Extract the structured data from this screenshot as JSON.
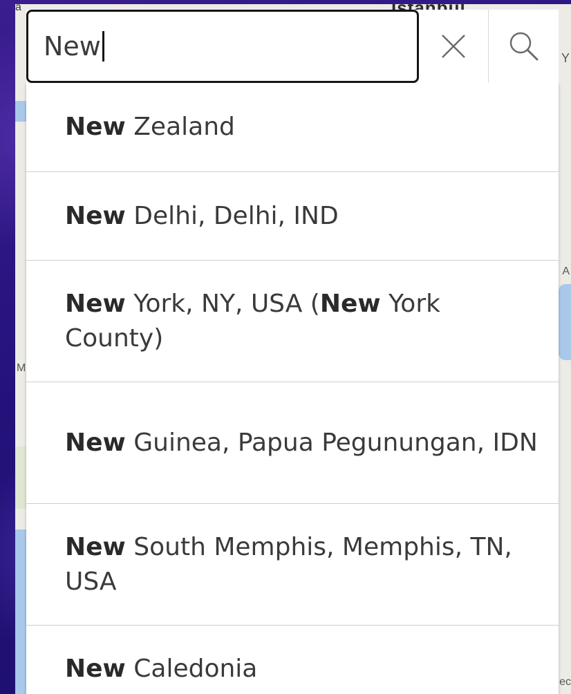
{
  "map": {
    "labels": {
      "istanbul": "Istanbul",
      "edge_y": "Y",
      "edge_m": "M",
      "edge_a": "A",
      "edge_ec": "ec",
      "edge_top_left": "a"
    }
  },
  "search": {
    "query": "New",
    "clear_icon": "close-icon",
    "search_icon": "search-icon",
    "suggestions": [
      {
        "match": "New",
        "rest": " Zealand"
      },
      {
        "match": "New",
        "rest": " Delhi, Delhi, IND"
      },
      {
        "match": "New",
        "rest": " York, NY, USA (",
        "match2": "New",
        "rest2": " York County)"
      },
      {
        "match": "New",
        "rest": " Guinea, Papua Pegunungan, IDN"
      },
      {
        "match": "New",
        "rest": " South Memphis, Memphis, TN, USA"
      },
      {
        "match": "New",
        "rest": " Caledonia"
      }
    ]
  },
  "colors": {
    "frame_purple": "#24127a",
    "input_border": "#151515",
    "map_background": "#ecebe6",
    "water": "#a9c8ea"
  }
}
